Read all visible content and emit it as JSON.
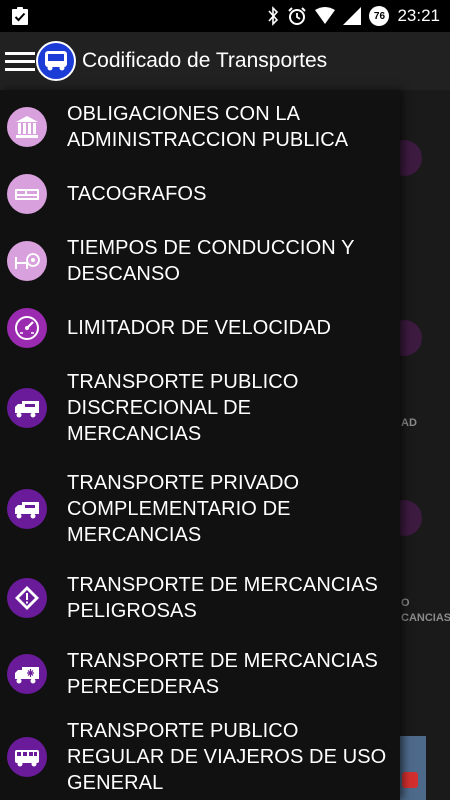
{
  "status_bar": {
    "time": "23:21",
    "battery_level": "76"
  },
  "header": {
    "title": "Codificado de Transportes"
  },
  "colors": {
    "light_purple": "#d9a0de",
    "mid_purple": "#9a2ab0",
    "dark_purple": "#6a1b9a",
    "accent_blue": "#1b3cd6"
  },
  "menu": [
    {
      "label": "OBLIGACIONES CON LA ADMINISTRACCION PUBLICA",
      "icon": "government-building-icon"
    },
    {
      "label": "TACOGRAFOS",
      "icon": "tachograph-icon"
    },
    {
      "label": "TIEMPOS DE CONDUCCION Y DESCANSO",
      "icon": "rest-bed-icon"
    },
    {
      "label": "LIMITADOR DE VELOCIDAD",
      "icon": "speedometer-icon"
    },
    {
      "label": "TRANSPORTE PUBLICO DISCRECIONAL DE MERCANCIAS",
      "icon": "truck-icon"
    },
    {
      "label": "TRANSPORTE PRIVADO COMPLEMENTARIO DE MERCANCIAS",
      "icon": "truck-icon"
    },
    {
      "label": "TRANSPORTE DE MERCANCIAS PELIGROSAS",
      "icon": "hazard-diamond-icon"
    },
    {
      "label": "TRANSPORTE DE MERCANCIAS PERECEDERAS",
      "icon": "refrigerated-truck-icon"
    },
    {
      "label": "TRANSPORTE PUBLICO REGULAR DE VIAJEROS DE USO GENERAL",
      "icon": "bus-icon"
    }
  ],
  "background": {
    "partial_text_1": "AD",
    "partial_text_2": "O",
    "partial_text_3": "CANCIAS"
  }
}
